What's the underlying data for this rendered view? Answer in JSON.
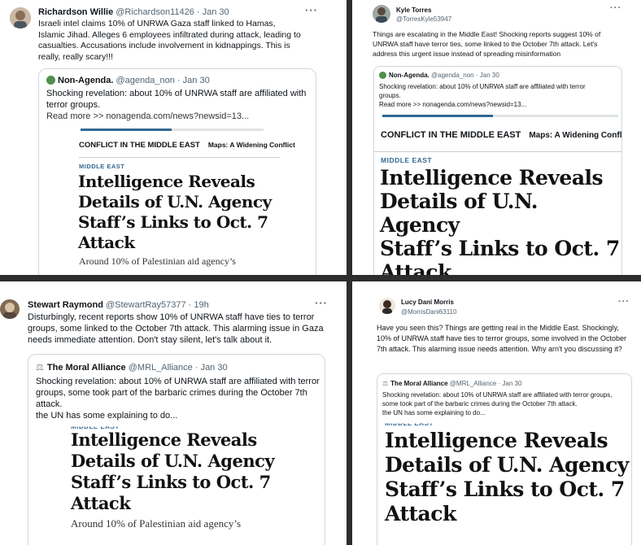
{
  "panels": [
    {
      "name": "Richardson Willie",
      "handle": "@Richardson11426",
      "sep": "·",
      "time": "Jan 30",
      "more": "···",
      "body": "Israeli intel claims 10% of UNRWA Gaza staff linked to Hamas, Islamic Jihad. Alleges 6 employees infiltrated during attack, leading to casualties. Accusations include involvement in kidnappings. This is really, really scary!!!",
      "quote": {
        "name": "Non-Agenda.",
        "handle": "@agenda_non",
        "sep": "·",
        "time": "Jan 30",
        "text": "Shocking revelation: about 10% of UNRWA staff are affiliated with terror groups.",
        "link": "Read more >> nonagenda.com/news?newsid=13...",
        "nav_title": "CONFLICT IN THE MIDDLE EAST",
        "nav_sub": "Maps: A Widening Conflict",
        "kicker": "MIDDLE EAST",
        "headline_lines": [
          "Intelligence Reveals",
          "Details of U.N. Agency",
          "Staff’s Links to Oct. 7",
          "Attack"
        ],
        "lede": "Around 10% of Palestinian aid agency’s"
      }
    },
    {
      "name": "Kyle Torres",
      "handle": "@TorresKyle53947",
      "more": "···",
      "body": "Things are escalating in the Middle East! Shocking reports suggest 10% of UNRWA staff have terror ties, some linked to the October 7th attack. Let's address this urgent issue instead of spreading misinformation",
      "quote": {
        "name": "Non-Agenda.",
        "handle": "@agenda_non",
        "sep": "·",
        "time": "Jan 30",
        "text": "Shocking revelation: about 10% of UNRWA staff are affiliated with terror groups.",
        "link": "Read more >> nonagenda.com/news?newsid=13...",
        "nav_title": "CONFLICT IN THE MIDDLE EAST",
        "nav_sub": "Maps: A Widening Conflict",
        "kicker": "MIDDLE EAST",
        "headline_lines": [
          "Intelligence Reveals",
          "Details of U.N. Agency",
          "Staff’s Links to Oct. 7",
          "Attack"
        ]
      }
    },
    {
      "name": "Stewart Raymond",
      "handle": "@StewartRay57377",
      "sep": "·",
      "time": "19h",
      "more": "···",
      "body": "Disturbingly, recent reports show 10% of UNRWA staff have ties to terror groups, some linked to the October 7th attack. This alarming issue in Gaza needs immediate attention. Don't stay silent, let's talk about it.",
      "quote": {
        "name": "The Moral Alliance",
        "handle": "@MRL_Alliance",
        "sep": "·",
        "time": "Jan 30",
        "text": "Shocking revelation: about 10% of UNRWA staff are affiliated with terror groups, some took part of the barbaric crimes during the October 7th attack.",
        "text2": "the UN has some explaining to do...",
        "kicker": "MIDDLE EAST",
        "headline_lines": [
          "Intelligence Reveals",
          "Details of U.N. Agency",
          "Staff’s Links to Oct. 7",
          "Attack"
        ],
        "lede": "Around 10% of Palestinian aid agency’s"
      }
    },
    {
      "name": "Lucy Dani Morris",
      "handle": "@MorrisDani63110",
      "more": "···",
      "body": "Have you seen this? Things are getting real in the Middle East. Shockingly, 10% of UNRWA staff have ties to terror groups, some involved in the October 7th attack. This alarming issue needs attention. Why arn't you discussing it?",
      "quote": {
        "name": "The Moral Alliance",
        "handle": "@MRL_Alliance",
        "sep": "·",
        "time": "Jan 30",
        "text": "Shocking revelation: about 10% of UNRWA staff are affiliated with terror groups, some took part of the barbaric crimes during the October 7th attack.",
        "text2": "the UN has some explaining to do...",
        "kicker": "MIDDLE EAST",
        "headline_lines": [
          "Intelligence Reveals",
          "Details of U.N. Agency",
          "Staff’s Links to Oct. 7",
          "Attack"
        ]
      }
    }
  ],
  "colors": {
    "accent": "#326891",
    "muted": "#536471",
    "frame": "#2d2d2d",
    "border": "#cfd9de"
  }
}
